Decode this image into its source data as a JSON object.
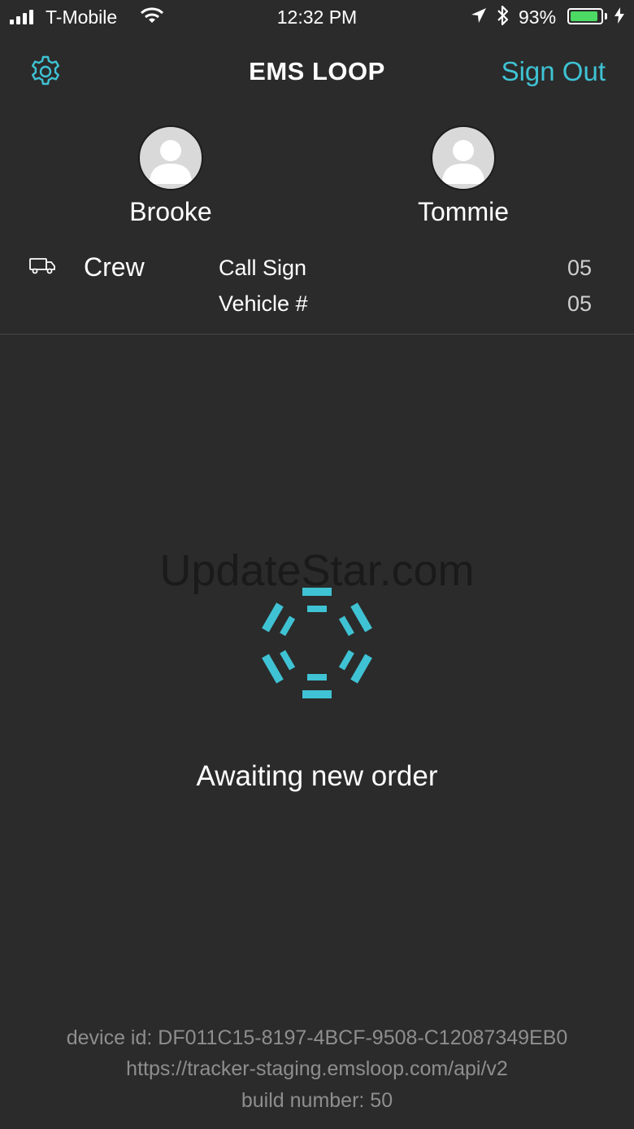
{
  "status_bar": {
    "carrier": "T-Mobile",
    "time": "12:32 PM",
    "battery_percent": "93%",
    "battery_level": 0.93,
    "battery_color": "#4cd964"
  },
  "nav": {
    "title": "EMS LOOP",
    "sign_out": "Sign Out",
    "settings_icon": "gear-icon",
    "accent_color": "#3fc3d4"
  },
  "crew_members": [
    {
      "name": "Brooke",
      "avatar_icon": "person-placeholder-icon"
    },
    {
      "name": "Tommie",
      "avatar_icon": "person-placeholder-icon"
    }
  ],
  "crew": {
    "label": "Crew",
    "icon": "truck-icon",
    "call_sign_label": "Call Sign",
    "call_sign_value": "05",
    "vehicle_label": "Vehicle #",
    "vehicle_value": "05"
  },
  "watermark": "UpdateStar.com",
  "status_message": "Awaiting new order",
  "spinner_icon": "loading-spinner-icon",
  "footer": {
    "device_id": "device id: DF011C15-8197-4BCF-9508-C12087349EB0",
    "api_url": "https://tracker-staging.emsloop.com/api/v2",
    "build_number": "build number: 50"
  }
}
